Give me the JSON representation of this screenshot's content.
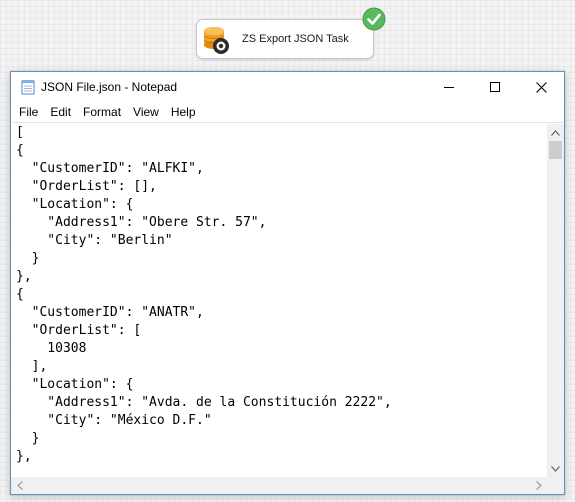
{
  "task": {
    "label": "ZS Export JSON Task",
    "status": "success",
    "icon": "database-export-icon"
  },
  "window": {
    "title": "JSON File.json - Notepad",
    "controls": [
      "minimize",
      "maximize",
      "close"
    ]
  },
  "menu": {
    "items": [
      "File",
      "Edit",
      "Format",
      "View",
      "Help"
    ]
  },
  "editor": {
    "lines": [
      "[",
      "{",
      "  \"CustomerID\": \"ALFKI\",",
      "  \"OrderList\": [],",
      "  \"Location\": {",
      "    \"Address1\": \"Obere Str. 57\",",
      "    \"City\": \"Berlin\"",
      "  }",
      "},",
      "{",
      "  \"CustomerID\": \"ANATR\",",
      "  \"OrderList\": [",
      "    10308",
      "  ],",
      "  \"Location\": {",
      "    \"Address1\": \"Avda. de la Constitución 2222\",",
      "    \"City\": \"México D.F.\"",
      "  }",
      "},"
    ]
  },
  "colors": {
    "success": "#5cb85c",
    "window_border": "#6b8fb3",
    "scrollbar": "#f0f0f0",
    "scroll_thumb": "#cdcdcd"
  }
}
